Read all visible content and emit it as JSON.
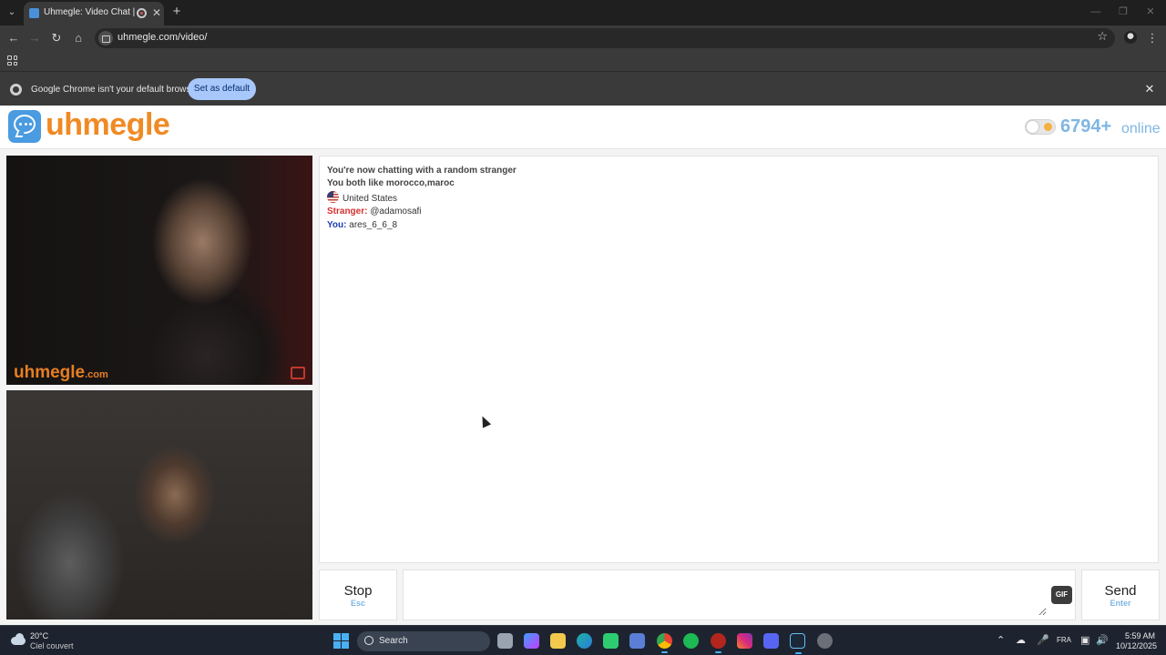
{
  "browser": {
    "tab_title": "Uhmegle: Video Chat | Ome",
    "url": "uhmegle.com/video/",
    "infobar_text": "Google Chrome isn't your default browser",
    "set_default_label": "Set as default"
  },
  "site": {
    "logo_text": "uhmegle",
    "online_count": "6794+",
    "online_label": "online",
    "watermark": "uhmegle",
    "watermark_suffix": ".com"
  },
  "chat": {
    "status_line": "You're now chatting with a random stranger",
    "interests_line": "You both like morocco,maroc",
    "country": "United States",
    "messages": [
      {
        "sender": "Stranger:",
        "text": "@adamosafi"
      },
      {
        "sender": "You:",
        "text": "ares_6_6_8"
      }
    ]
  },
  "controls": {
    "stop_label": "Stop",
    "stop_hint": "Esc",
    "gif_label": "GIF",
    "send_label": "Send",
    "send_hint": "Enter",
    "message_value": ""
  },
  "taskbar": {
    "temperature": "20°C",
    "weather": "Ciel couvert",
    "search_label": "Search",
    "language": "FRA",
    "time": "5:59 AM",
    "date": "10/12/2025"
  },
  "colors": {
    "brand_orange": "#f08a24",
    "brand_blue": "#4a9be0",
    "stranger_red": "#d62f2f",
    "you_blue": "#1f3fb5"
  },
  "icons": [
    "tab-list-icon",
    "video-chat-favicon",
    "recording-icon",
    "close-icon",
    "new-tab-icon",
    "back-icon",
    "forward-icon",
    "reload-icon",
    "home-icon",
    "star-icon",
    "profile-icon",
    "kebab-menu-icon",
    "apps-icon",
    "chrome-icon",
    "chat-bubble-icon",
    "theme-toggle",
    "us-flag-icon",
    "report-flag-icon",
    "gif-icon",
    "weather-icon",
    "windows-start-icon",
    "search-icon"
  ]
}
